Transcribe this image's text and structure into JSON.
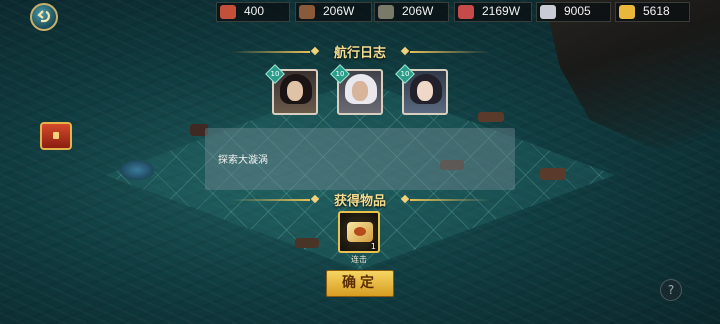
{
  "resources": [
    {
      "icon": "flag-icon",
      "value": "400",
      "color": "#c4503a"
    },
    {
      "icon": "cannon-icon",
      "value": "206W",
      "color": "#8a5a3a"
    },
    {
      "icon": "wood-icon",
      "value": "206W",
      "color": "#7a7a6a"
    },
    {
      "icon": "meat-icon",
      "value": "2169W",
      "color": "#c74a4a"
    },
    {
      "icon": "silver-ingot-icon",
      "value": "9005",
      "color": "#c9ccd4"
    },
    {
      "icon": "gold-ingot-icon",
      "value": "5618",
      "color": "#e9b83a"
    }
  ],
  "voyage_log": {
    "title": "航行日志",
    "entry": "探索大漩涡"
  },
  "heroes": [
    {
      "level": "10",
      "name": "long-hair-swordsman"
    },
    {
      "level": "10",
      "name": "white-hair-elder"
    },
    {
      "level": "10",
      "name": "lady-with-headdress"
    }
  ],
  "rewards": {
    "title": "获得物品",
    "items": [
      {
        "name": "连击",
        "count": "1"
      }
    ]
  },
  "confirm_label": "确定",
  "help_label": "?"
}
